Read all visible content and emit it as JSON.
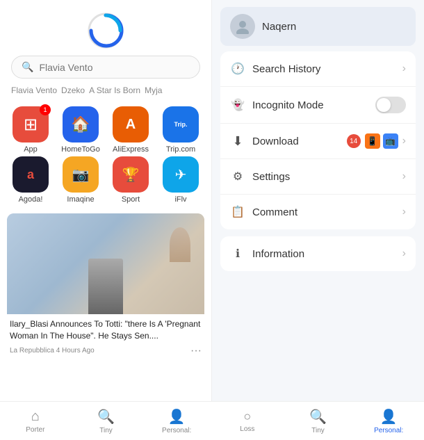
{
  "left": {
    "search_placeholder": "Flavia Vento",
    "suggestions": [
      "Flavia Vento",
      "Dzeko",
      "A Star Is Born",
      "Myja"
    ],
    "apps": [
      {
        "label": "App",
        "icon": "⊞",
        "color": "red",
        "badge": "1"
      },
      {
        "label": "HomeToGo",
        "icon": "🏠",
        "color": "blue"
      },
      {
        "label": "AliExpress",
        "icon": "A",
        "color": "orange"
      },
      {
        "label": "Trip.com",
        "icon": "Trip.",
        "color": "trip"
      },
      {
        "label": "Agoda!",
        "icon": "a",
        "color": "agoda"
      },
      {
        "label": "Imaqine",
        "icon": "📷",
        "color": "yellow"
      },
      {
        "label": "Sport",
        "icon": "🏆",
        "color": "trophy"
      },
      {
        "label": "iFlv",
        "icon": "✈",
        "color": "sky"
      }
    ],
    "news": {
      "title": "Ilary_Blasi Announces To Totti: \"there Is A 'Pregnant Woman In The House\". He Stays Sen....",
      "source": "La Repubblica 4 Hours Ago"
    }
  },
  "right": {
    "username": "Naqern",
    "menu_items": [
      {
        "id": "search-history",
        "label": "Search History",
        "icon": "🕐",
        "has_chevron": true
      },
      {
        "id": "incognito-mode",
        "label": "Incognito Mode",
        "icon": "👻",
        "has_toggle": true
      },
      {
        "id": "download",
        "label": "Download",
        "icon": "⬇",
        "badge": "14",
        "has_mini_icons": true,
        "has_chevron": true
      },
      {
        "id": "settings",
        "label": "Settings",
        "icon": "⚙",
        "has_chevron": true
      },
      {
        "id": "comment",
        "label": "Comment",
        "icon": "📋",
        "has_chevron": true
      },
      {
        "id": "information",
        "label": "Information",
        "icon": "ℹ",
        "has_chevron": true
      }
    ]
  },
  "bottom_nav": [
    {
      "label": "Porter",
      "icon": "home",
      "active": false
    },
    {
      "label": "Tiny",
      "icon": "search",
      "active": false
    },
    {
      "label": "Personal:",
      "icon": "person",
      "active": false
    },
    {
      "label": "Loss",
      "icon": "circle",
      "active": false
    },
    {
      "label": "Tiny",
      "icon": "search2",
      "active": false
    },
    {
      "label": "Personal:",
      "icon": "person2",
      "active": true
    }
  ]
}
